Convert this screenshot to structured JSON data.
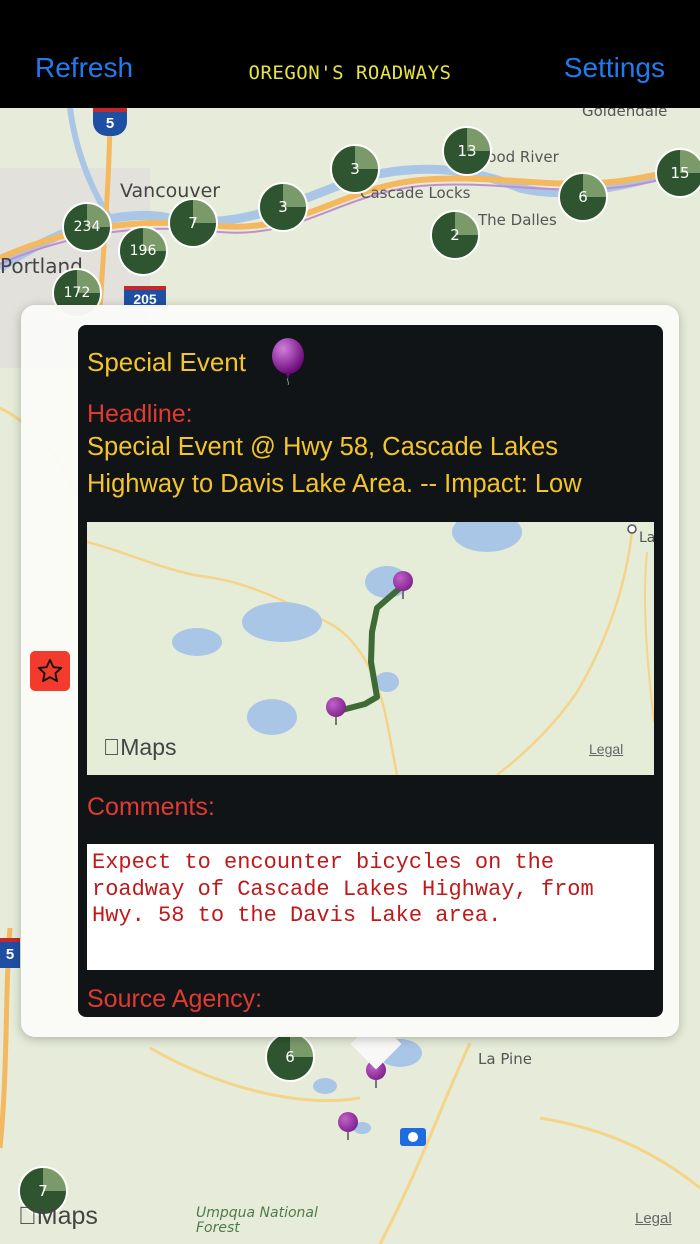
{
  "navbar": {
    "refresh_label": "Refresh",
    "title": "OREGON'S ROADWAYS",
    "settings_label": "Settings"
  },
  "map": {
    "places": {
      "vancouver": "Vancouver",
      "portland": "Portland",
      "hood_river": "Hood River",
      "cascade_locks": "Cascade Locks",
      "the_dalles": "The Dalles",
      "goldendale": "Goldendale",
      "la_pine": "La Pine",
      "umpqua": "Umpqua National",
      "umpqua2": "Forest"
    },
    "shields": {
      "i5": "5",
      "i205": "205",
      "i5b": "5"
    },
    "clusters": [
      "13",
      "15",
      "3",
      "6",
      "3",
      "234",
      "7",
      "196",
      "2",
      "172",
      "6",
      "7"
    ],
    "brand": "Maps",
    "legal": "Legal"
  },
  "popup": {
    "event_type": "Special Event",
    "headline_label": "Headline:",
    "headline": "Special Event @ Hwy 58, Cascade Lakes Highway to Davis Lake Area. -- Impact: Low",
    "comments_label": "Comments:",
    "comments": "Expect to encounter bicycles on the roadway of Cascade Lakes Highway, from Hwy. 58 to the Davis Lake area.",
    "source_label": "Source Agency:",
    "mini_map_brand": "Maps",
    "mini_map_legal": "Legal",
    "mini_map_place": "La"
  },
  "colors": {
    "nav_link": "#1e7cf0",
    "title": "#e8e63a",
    "label_red": "#e13a30",
    "text_yellow": "#f4c52a",
    "comment_red": "#c0191b",
    "star_bg": "#f23b2c"
  }
}
